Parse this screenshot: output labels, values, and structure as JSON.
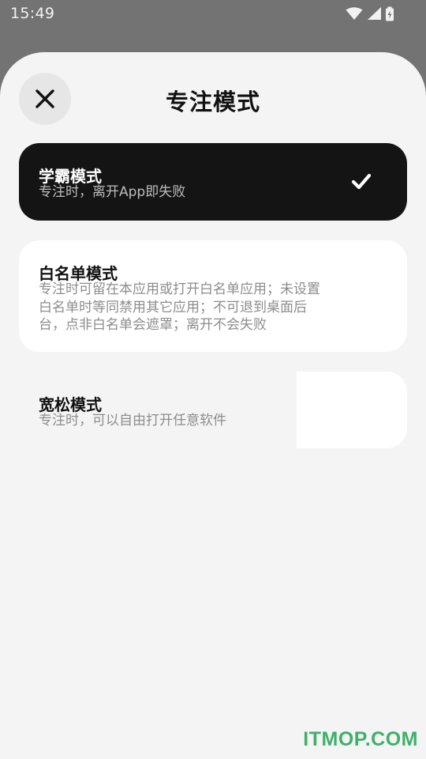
{
  "status_bar": {
    "time": "15:49",
    "icons": [
      "wifi-icon",
      "signal-icon",
      "battery-charging-icon"
    ]
  },
  "sheet": {
    "title": "专注模式",
    "close_icon": "close-icon"
  },
  "modes": [
    {
      "title": "学霸模式",
      "description": "专注时，离开App即失败",
      "selected": true
    },
    {
      "title": "白名单模式",
      "description_lines": [
        "专注时可留在本应用或打开白名单应用；未设置",
        "白名单时等同禁用其它应用；不可退到桌面后",
        "台，点非白名单会遮罩；离开不会失败"
      ],
      "selected": false
    },
    {
      "title": "宽松模式",
      "description": "专注时，可以自由打开任意软件",
      "selected": false
    }
  ],
  "watermark": "ITMOP.COM",
  "colors": {
    "selected_card": "#141414",
    "card": "#ffffff",
    "sheet_bg": "#f4f4f4",
    "overlay": "#737373",
    "watermark": "#3fb06a"
  }
}
